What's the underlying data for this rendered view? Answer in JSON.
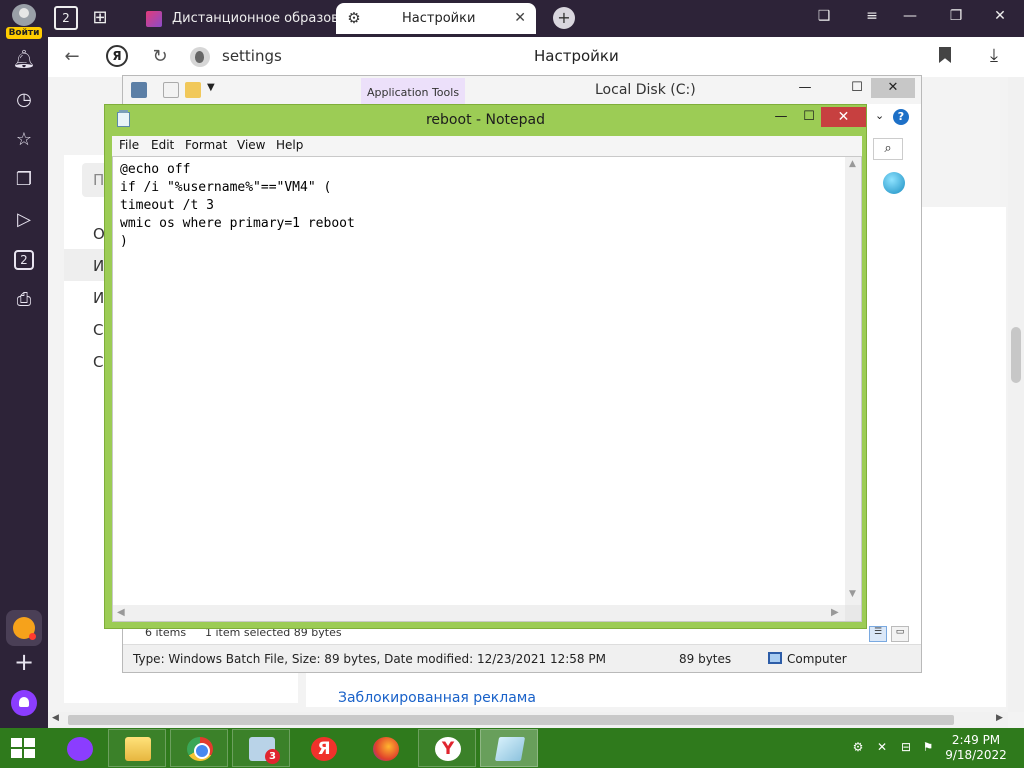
{
  "browser": {
    "profile": {
      "login_label": "Войти"
    },
    "sidebar": {
      "counter_badge": "2"
    },
    "tabbar": {
      "tab_count": "2",
      "tabs": [
        {
          "title": "Дистанционное образова",
          "active": false
        },
        {
          "title": "Настройки",
          "active": true
        }
      ]
    },
    "addressbar": {
      "yandex_button": "Я",
      "url": "settings",
      "page_title": "Настройки"
    },
    "page": {
      "left_menu_letters": [
        "П",
        "О",
        "И",
        "И",
        "С",
        "С"
      ],
      "blocked_ads_link": "Заблокированная реклама"
    }
  },
  "explorer": {
    "ribbon_context_tab": "Application Tools",
    "title": "Local Disk (C:)",
    "status": {
      "items_count": "6 items",
      "selection": "1 item selected  89 bytes"
    },
    "details": {
      "info": "Type: Windows Batch File, Size: 89 bytes, Date modified: 12/23/2021 12:58 PM",
      "size": "89 bytes",
      "location": "Computer"
    }
  },
  "notepad": {
    "title": "reboot - Notepad",
    "menu": [
      "File",
      "Edit",
      "Format",
      "View",
      "Help"
    ],
    "content": "@echo off\nif /i \"%username%\"==\"VM4\" (\ntimeout /t 3\nwmic os where primary=1 reboot\n)"
  },
  "taskbar": {
    "magnifier_badge": "3",
    "yandex_letter": "Я",
    "yandex_browser_letter": "Y",
    "clock": {
      "time": "2:49 PM",
      "date": "9/18/2022"
    }
  },
  "colors": {
    "browser_dark": "#2d2338",
    "notepad_frame": "#9ccc55",
    "taskbar": "#2f7a1c",
    "close_red": "#c74040"
  }
}
